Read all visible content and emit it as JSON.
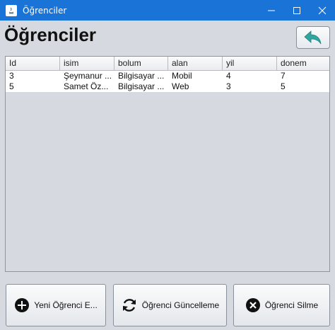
{
  "window": {
    "title": "Öğrenciler"
  },
  "page": {
    "heading": "Öğrenciler"
  },
  "table": {
    "columns": [
      "Id",
      "isim",
      "bolum",
      "alan",
      "yil",
      "donem"
    ],
    "rows": [
      [
        "3",
        "Şeymanur ...",
        "Bilgisayar ...",
        "Mobil",
        "4",
        "7"
      ],
      [
        "5",
        "Samet Öz...",
        "Bilgisayar ...",
        "Web",
        "3",
        "5"
      ]
    ]
  },
  "actions": {
    "add_label": "Yeni Öğrenci E...",
    "update_label": "Öğrenci Güncelleme",
    "delete_label": "Öğrenci Silme"
  },
  "colors": {
    "titlebar": "#1a73d6",
    "back_arrow": "#2fa7a0",
    "background": "#d6d9df"
  }
}
